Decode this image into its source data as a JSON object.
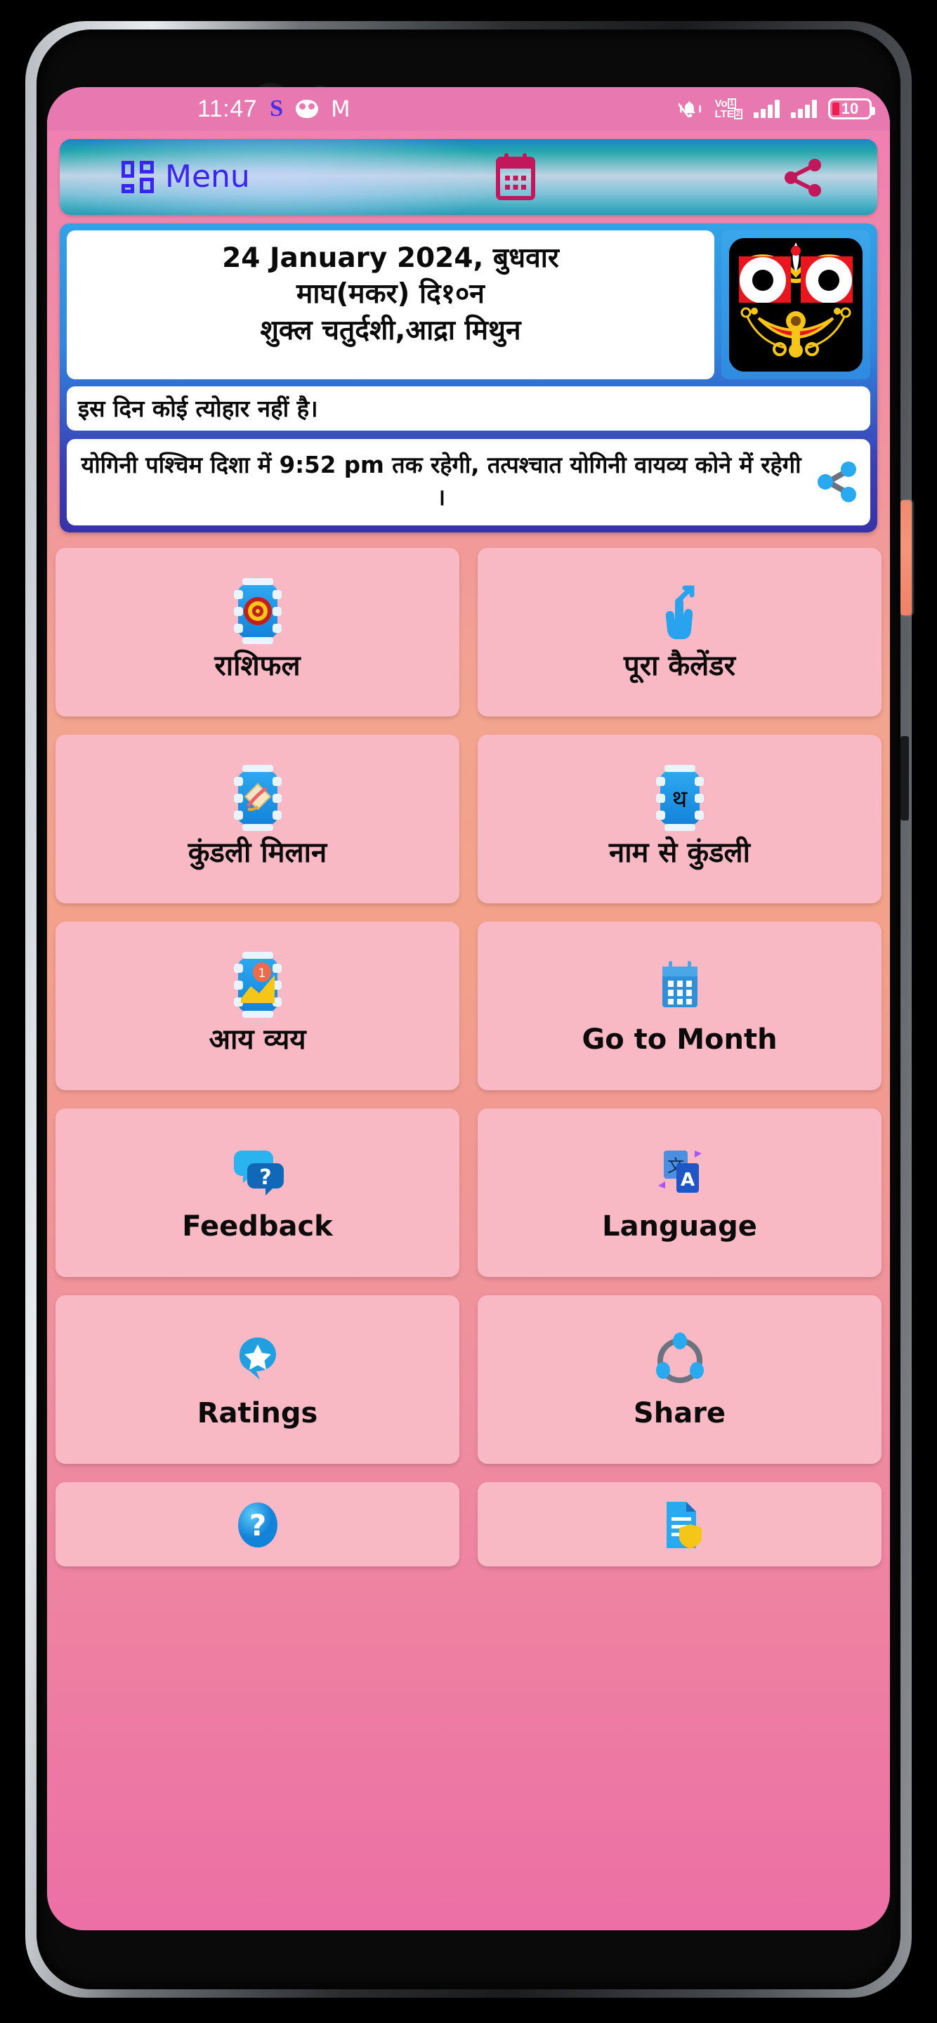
{
  "status_bar": {
    "time": "11:47",
    "icons_left": [
      "snapchat-s-icon",
      "owl-icon",
      "gmail-m-icon"
    ],
    "icons_right": [
      "bell-off-icon",
      "volte-icon",
      "signal-sim1-icon",
      "signal-sim2-icon"
    ],
    "volte_label": "VoLTE",
    "sim1_label": "1",
    "sim2_label": "2",
    "battery_percent": "10",
    "bar_color": "#e879b0"
  },
  "menu_bar": {
    "menu_label": "Menu",
    "menu_icon": "grid-icon",
    "calendar_icon": "calendar-icon",
    "share_icon": "share-icon",
    "accent_color": "#3a26f0",
    "icon_color": "#c2185b"
  },
  "info_card": {
    "date_lines": [
      "24 January 2024, बुधवार",
      "माघ(मकर) दि१०न",
      "शुक्ल चतुर्दशी,आद्रा मिथुन"
    ],
    "deity_image": "jagannath-face-image",
    "festival_text": "इस दिन कोई त्योहार नहीं है।",
    "yogini_text": "योगिनी पश्चिम दिशा में 9:52 pm तक रहेगी, तत्पश्चात योगिनी वायव्य कोने में रहेगी ।",
    "yogini_share_icon": "share-icon",
    "card_gradient_from": "#31a2e8",
    "card_gradient_to": "#3832a8"
  },
  "tiles": [
    {
      "label": "राशिफल",
      "icon": "zodiac-wheel-icon"
    },
    {
      "label": "पूरा कैलेंडर",
      "icon": "pointing-hand-icon"
    },
    {
      "label": "कुंडली मिलान",
      "icon": "horoscope-match-icon"
    },
    {
      "label": "नाम से कुंडली",
      "icon": "name-letter-icon"
    },
    {
      "label": "आय व्यय",
      "icon": "income-expense-chart-icon"
    },
    {
      "label": "Go to Month",
      "icon": "calendar-icon"
    },
    {
      "label": "Feedback",
      "icon": "chat-question-icon"
    },
    {
      "label": "Language",
      "icon": "translate-icon"
    },
    {
      "label": "Ratings",
      "icon": "star-bubble-icon"
    },
    {
      "label": "Share",
      "icon": "share-circle-icon"
    },
    {
      "label": "",
      "icon": "help-question-icon"
    },
    {
      "label": "",
      "icon": "privacy-policy-icon"
    }
  ],
  "theme": {
    "tile_bg": "#f9b9c4",
    "screen_top": "#f07db4",
    "screen_mid": "#f3a189",
    "screen_bottom": "#ec6fa5",
    "side_button": "#f08a6e"
  }
}
